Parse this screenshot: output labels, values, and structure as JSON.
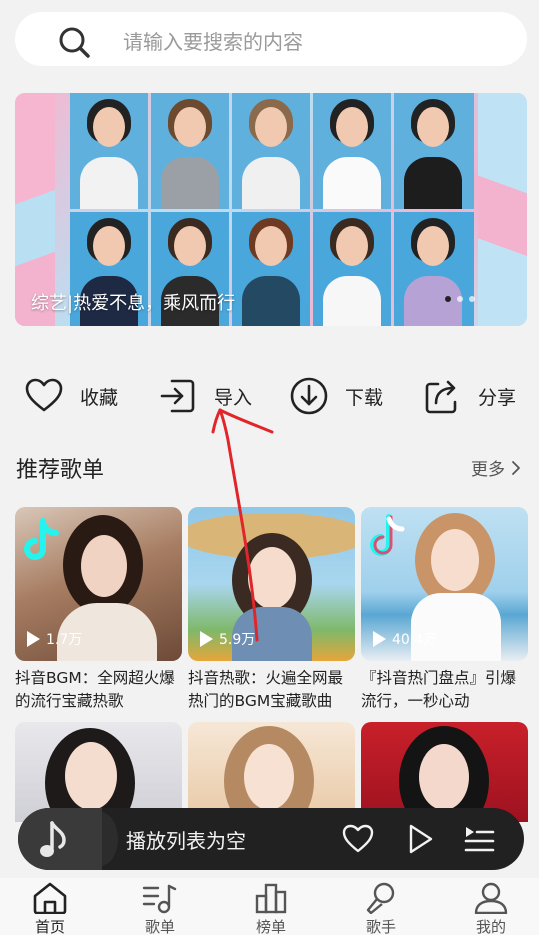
{
  "search": {
    "placeholder": "请输入要搜索的内容"
  },
  "banner": {
    "caption": "综艺|热爱不息，乘风而行"
  },
  "actions": [
    {
      "label": "收藏",
      "icon": "heart-icon"
    },
    {
      "label": "导入",
      "icon": "import-icon"
    },
    {
      "label": "下载",
      "icon": "download-icon"
    },
    {
      "label": "分享",
      "icon": "share-icon"
    }
  ],
  "recommend": {
    "title": "推荐歌单",
    "more": "更多",
    "playlists": [
      {
        "plays": "1.7万",
        "title": "抖音BGM：全网超火爆的流行宝藏热歌"
      },
      {
        "plays": "5.9万",
        "title": "抖音热歌：火遍全网最热门的BGM宝藏歌曲"
      },
      {
        "plays": "40.4万",
        "title": "『抖音热门盘点』引爆流行，一秒心动"
      }
    ]
  },
  "player": {
    "status": "播放列表为空"
  },
  "tabs": [
    {
      "label": "首页",
      "icon": "home-icon",
      "active": true
    },
    {
      "label": "歌单",
      "icon": "playlist-icon",
      "active": false
    },
    {
      "label": "榜单",
      "icon": "chart-icon",
      "active": false
    },
    {
      "label": "歌手",
      "icon": "microphone-icon",
      "active": false
    },
    {
      "label": "我的",
      "icon": "user-icon",
      "active": false
    }
  ],
  "colors": {
    "accent_annotation": "#e0262b",
    "player_bg": "#212121"
  }
}
